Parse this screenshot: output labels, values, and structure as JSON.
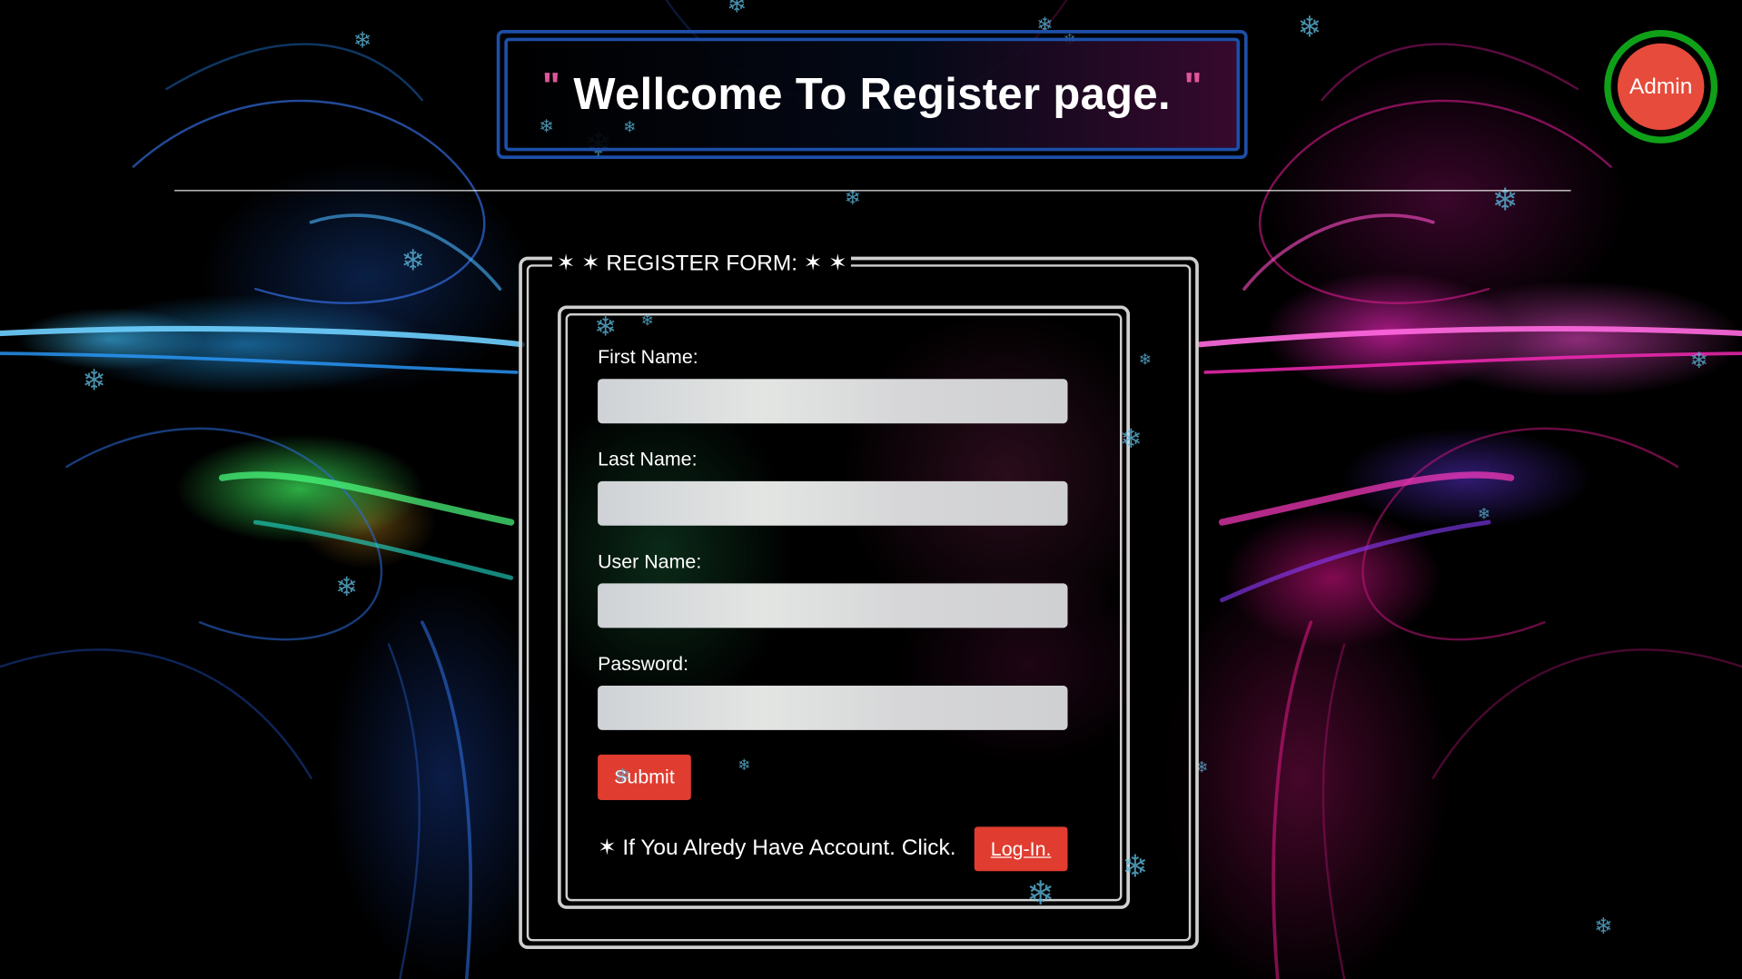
{
  "header": {
    "quote_open": "\"",
    "title": "Wellcome To Register page.",
    "quote_close": "\""
  },
  "admin_button": {
    "label": "Admin"
  },
  "form": {
    "legend": "✶ ✶ REGISTER FORM: ✶ ✶",
    "fields": [
      {
        "label": "First Name:",
        "value": ""
      },
      {
        "label": "Last Name:",
        "value": ""
      },
      {
        "label": "User Name:",
        "value": ""
      },
      {
        "label": "Password:",
        "value": ""
      }
    ],
    "submit_label": "Submit",
    "account_text": "✶ If You Alredy Have Account. Click.",
    "login_label": "Log-In."
  },
  "colors": {
    "accent_red": "#e03c2f",
    "admin_ring": "#0fa018",
    "title_border": "#1d4fa8",
    "quote_pink": "#e0559b"
  },
  "icons": {
    "snowflake": "snowflake-icon",
    "star": "star-icon"
  }
}
